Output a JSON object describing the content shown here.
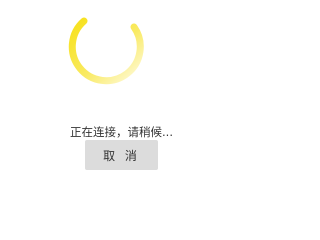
{
  "status": {
    "text": "正在连接，请稍候..."
  },
  "actions": {
    "cancel_label": "取 消"
  },
  "spinner": {
    "icon": "loading-spinner-icon",
    "color_start": "#f7e11a",
    "color_end": "#fff9cf"
  }
}
